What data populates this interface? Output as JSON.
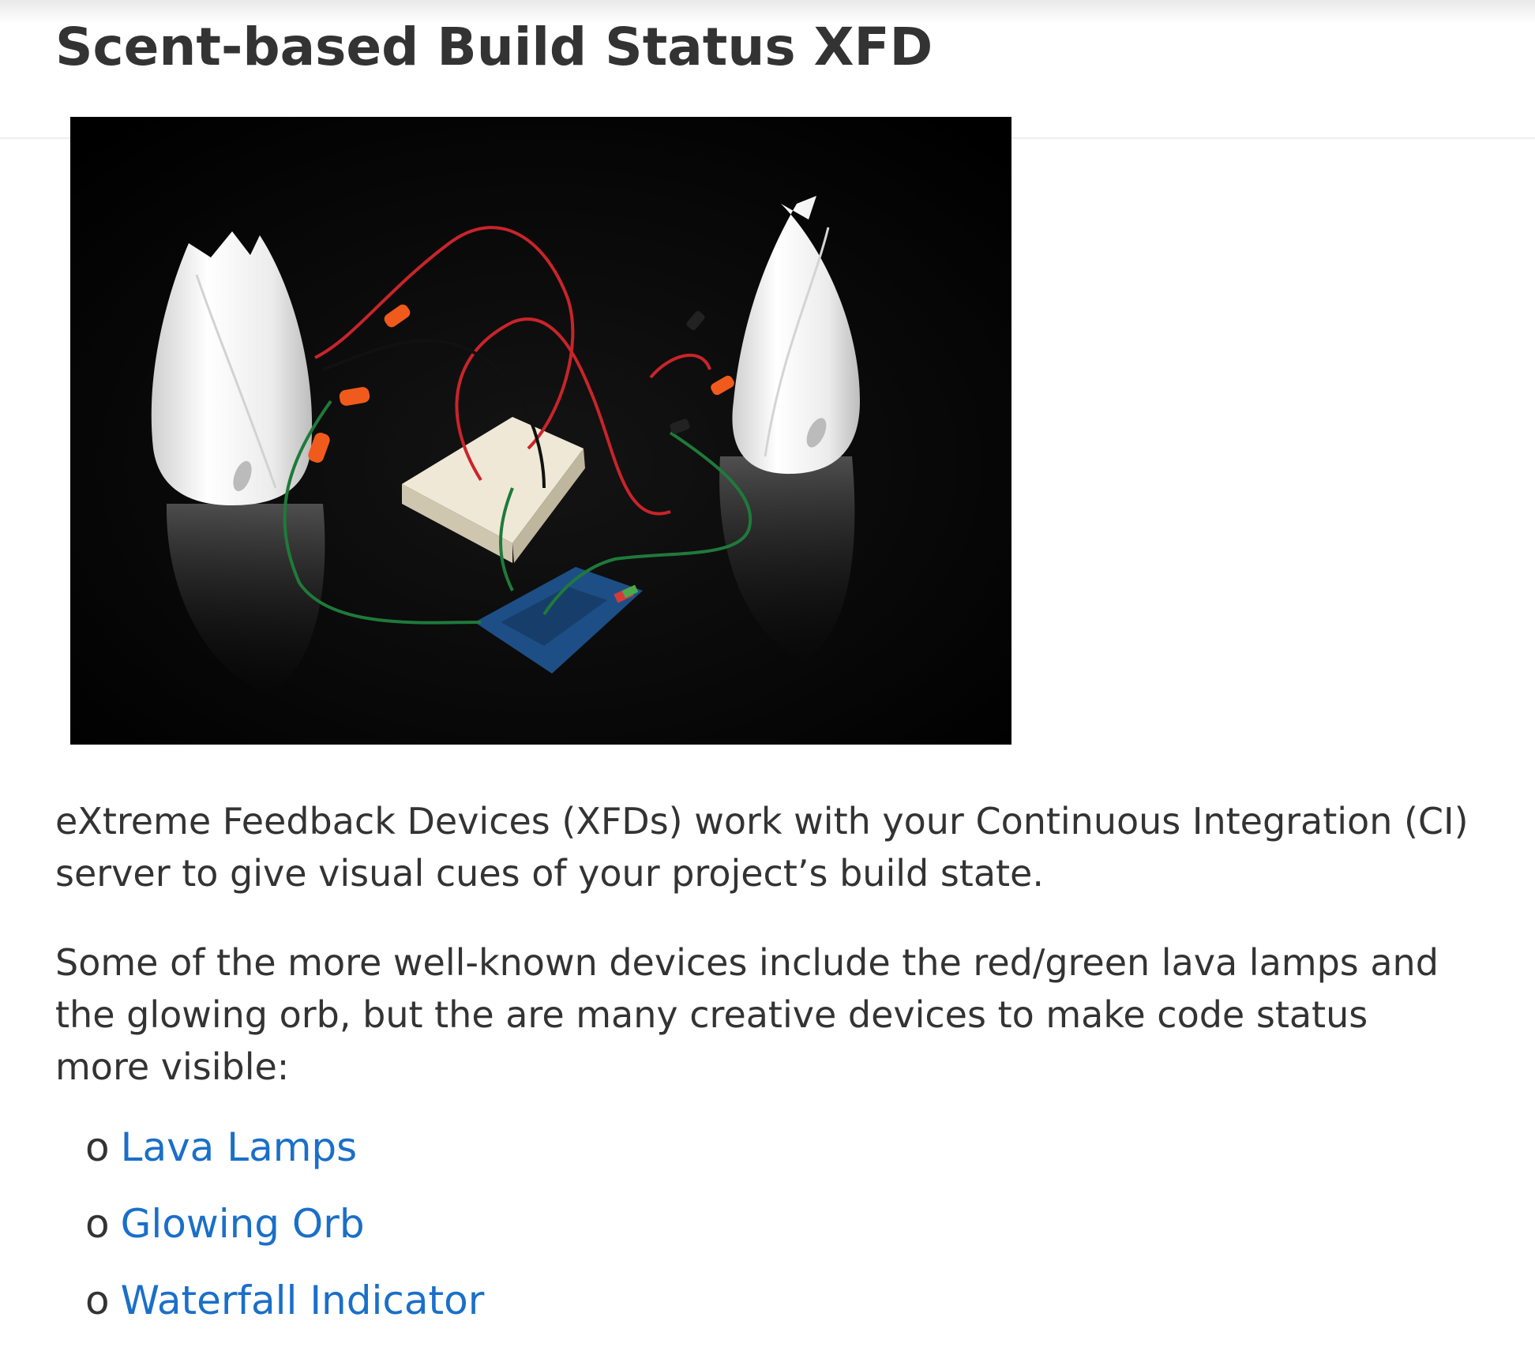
{
  "page": {
    "title": "Scent-based Build Status XFD"
  },
  "content": {
    "paragraph1": "eXtreme Feedback Devices (XFDs) work with your Continuous Integration (CI) server to give visual cues of your project’s build state.",
    "paragraph2": "Some of the more well-known devices include the red/green lava lamps and the glowing orb, but the are many creative devices to make code status more visible:",
    "bullet_glyph": "o",
    "devices": [
      {
        "label": "Lava Lamps"
      },
      {
        "label": "Glowing Orb"
      },
      {
        "label": "Waterfall Indicator"
      }
    ]
  },
  "colors": {
    "text": "#333333",
    "link": "#1a6fc9",
    "photo_background": "#000000"
  }
}
